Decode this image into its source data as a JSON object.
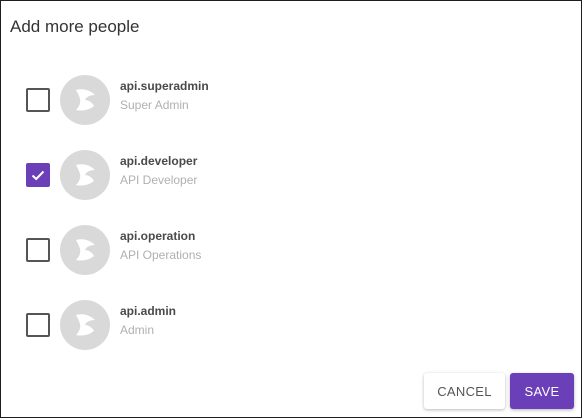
{
  "dialog": {
    "title": "Add more people"
  },
  "people": [
    {
      "name": "api.superadmin",
      "role": "Super Admin",
      "checked": false
    },
    {
      "name": "api.developer",
      "role": "API Developer",
      "checked": true
    },
    {
      "name": "api.operation",
      "role": "API Operations",
      "checked": false
    },
    {
      "name": "api.admin",
      "role": "Admin",
      "checked": false
    }
  ],
  "actions": {
    "cancel_label": "CANCEL",
    "save_label": "SAVE"
  },
  "icons": {
    "avatar": "user-avatar-icon",
    "check": "check-icon"
  },
  "colors": {
    "accent": "#6a3fb8",
    "avatar_bg": "#d9d9d9",
    "role_text": "#b0b0b0"
  }
}
